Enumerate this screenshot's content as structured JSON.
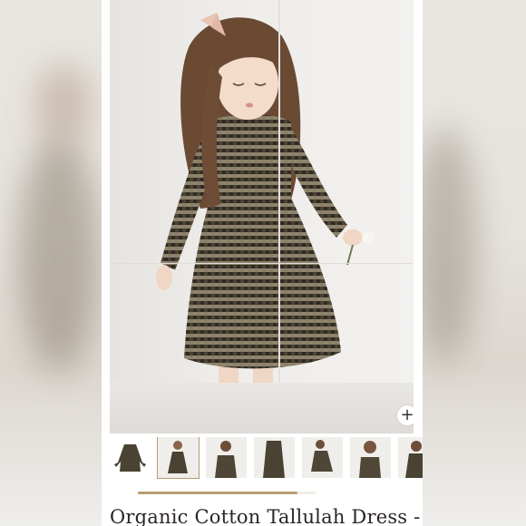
{
  "product": {
    "title": "Organic Cotton Tallulah Dress -",
    "dress_color": "#4a4233",
    "check_color": "#c9bca0"
  },
  "gallery": {
    "zoom_icon": "plus-icon",
    "zoom_label": "+",
    "thumbnail_count": 7,
    "selected_index": 1,
    "scroll_progress": 0.9
  },
  "colors": {
    "accent": "#b89c70",
    "text": "#2b2623"
  }
}
